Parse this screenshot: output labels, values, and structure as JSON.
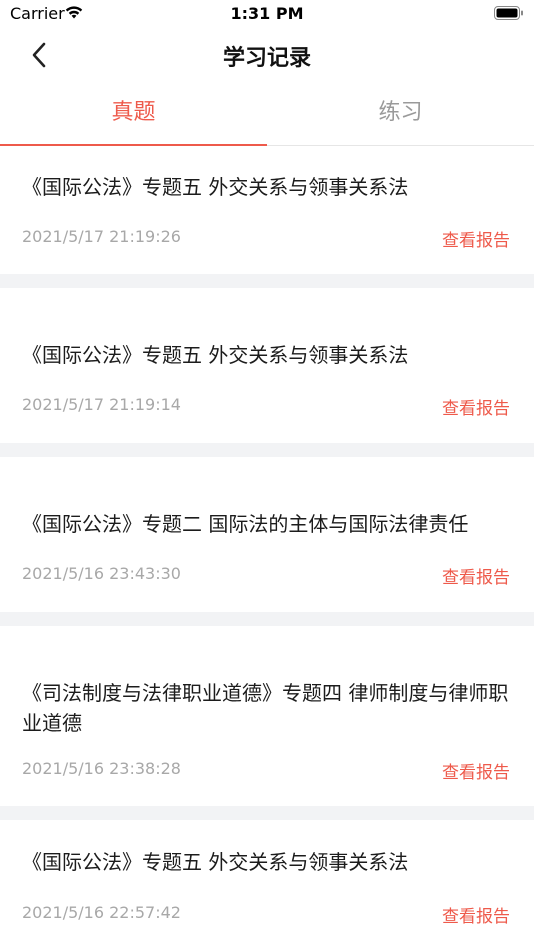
{
  "status": {
    "carrier": "Carrier",
    "time": "1:31 PM"
  },
  "nav": {
    "title": "学习记录"
  },
  "tabs": [
    {
      "label": "真题"
    },
    {
      "label": "练习"
    }
  ],
  "records": [
    {
      "title": "《国际公法》专题五 外交关系与领事关系法",
      "time": "2021/5/17 21:19:26",
      "action": "查看报告"
    },
    {
      "title": "《国际公法》专题五 外交关系与领事关系法",
      "time": "2021/5/17 21:19:14",
      "action": "查看报告"
    },
    {
      "title": "《国际公法》专题二 国际法的主体与国际法律责任",
      "time": "2021/5/16 23:43:30",
      "action": "查看报告"
    },
    {
      "title": "《司法制度与法律职业道德》专题四 律师制度与律师职业道德",
      "time": "2021/5/16 23:38:28",
      "action": "查看报告"
    },
    {
      "title": "《国际公法》专题五 外交关系与领事关系法",
      "time": "2021/5/16 22:57:42",
      "action": "查看报告"
    }
  ],
  "colors": {
    "accent": "#ee5a4b",
    "muted_text": "#a8a8a8",
    "separator": "#f2f3f5"
  }
}
